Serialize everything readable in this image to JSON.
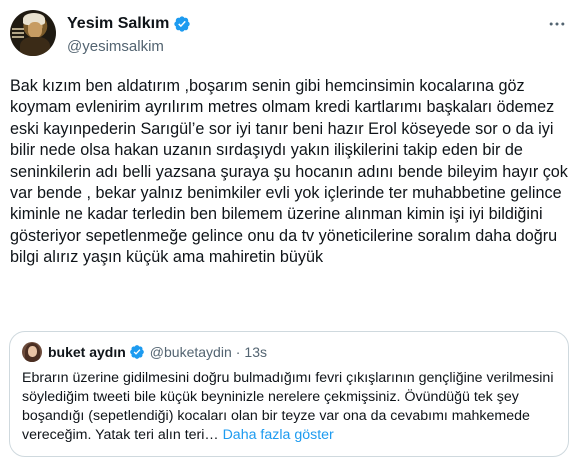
{
  "author": {
    "display_name": "Yesim Salkım",
    "handle": "@yesimsalkim"
  },
  "tweet": {
    "text": "Bak kızım ben aldatırım ,boşarım senin gibi hemcinsimin kocalarına göz koymam evlenirim ayrılırım metres olmam kredi kartlarımı başkaları ödemez eski kayınpederin Sarıgül’e sor iyi tanır beni hazır Erol köseyede sor o da iyi bilir nede olsa hakan uzanın sırdaşıydı yakın ilişkilerini takip eden bir de seninkilerin adı belli yazsana şuraya şu hocanın adını bende bileyim hayır çok var bende , bekar yalnız benimkiler evli yok içlerinde ter muhabbetine gelince kiminle ne kadar terledin ben bilemem üzerine alınman kimin işi iyi bildiğini gösteriyor sepetlenmeğe gelince onu da tv yöneticilerine soralım daha doğru bilgi alırız yaşın küçük ama mahiretin büyük"
  },
  "quote": {
    "display_name": "buket aydın",
    "handle": "@buketaydin",
    "separator": "·",
    "time": "13s",
    "text": "Ebrarın üzerine gidilmesini doğru bulmadığımı fevri çıkışlarının  gençliğine verilmesini söylediğim tweeti bile küçük beyninizle nerelere çekmişsiniz. Övündüğü tek şey boşandığı (sepetlendiği) kocaları olan bir teyze var ona da cevabımı mahkemede vereceğim. Yatak teri alın teri…",
    "show_more": "Daha fazla göster"
  },
  "colors": {
    "text": "#0f1419",
    "secondary": "#536471",
    "link": "#1d9bf0",
    "verified": "#1d9bf0",
    "border": "#cfd9de"
  },
  "icons": {
    "more": "more-horizontal-icon",
    "verified": "verified-badge-icon"
  }
}
